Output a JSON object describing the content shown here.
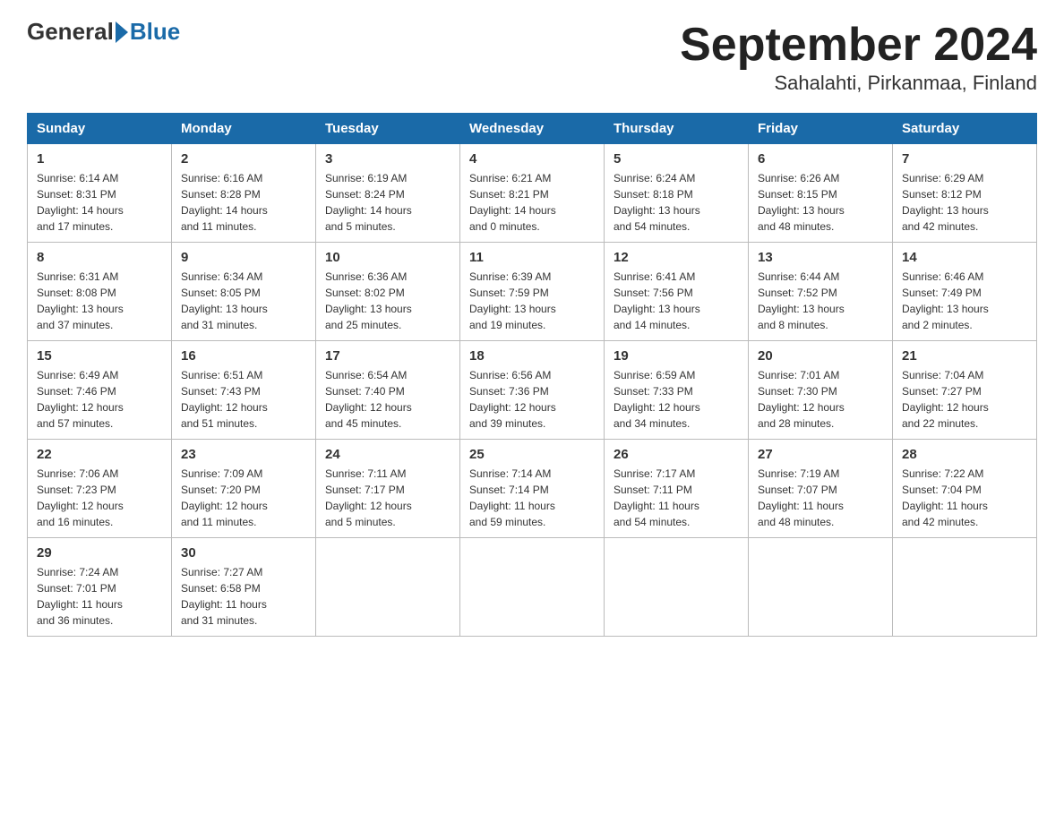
{
  "header": {
    "logo_general": "General",
    "logo_blue": "Blue",
    "month_title": "September 2024",
    "location": "Sahalahti, Pirkanmaa, Finland"
  },
  "days_of_week": [
    "Sunday",
    "Monday",
    "Tuesday",
    "Wednesday",
    "Thursday",
    "Friday",
    "Saturday"
  ],
  "weeks": [
    [
      {
        "day": "1",
        "sunrise": "6:14 AM",
        "sunset": "8:31 PM",
        "daylight": "14 hours and 17 minutes."
      },
      {
        "day": "2",
        "sunrise": "6:16 AM",
        "sunset": "8:28 PM",
        "daylight": "14 hours and 11 minutes."
      },
      {
        "day": "3",
        "sunrise": "6:19 AM",
        "sunset": "8:24 PM",
        "daylight": "14 hours and 5 minutes."
      },
      {
        "day": "4",
        "sunrise": "6:21 AM",
        "sunset": "8:21 PM",
        "daylight": "14 hours and 0 minutes."
      },
      {
        "day": "5",
        "sunrise": "6:24 AM",
        "sunset": "8:18 PM",
        "daylight": "13 hours and 54 minutes."
      },
      {
        "day": "6",
        "sunrise": "6:26 AM",
        "sunset": "8:15 PM",
        "daylight": "13 hours and 48 minutes."
      },
      {
        "day": "7",
        "sunrise": "6:29 AM",
        "sunset": "8:12 PM",
        "daylight": "13 hours and 42 minutes."
      }
    ],
    [
      {
        "day": "8",
        "sunrise": "6:31 AM",
        "sunset": "8:08 PM",
        "daylight": "13 hours and 37 minutes."
      },
      {
        "day": "9",
        "sunrise": "6:34 AM",
        "sunset": "8:05 PM",
        "daylight": "13 hours and 31 minutes."
      },
      {
        "day": "10",
        "sunrise": "6:36 AM",
        "sunset": "8:02 PM",
        "daylight": "13 hours and 25 minutes."
      },
      {
        "day": "11",
        "sunrise": "6:39 AM",
        "sunset": "7:59 PM",
        "daylight": "13 hours and 19 minutes."
      },
      {
        "day": "12",
        "sunrise": "6:41 AM",
        "sunset": "7:56 PM",
        "daylight": "13 hours and 14 minutes."
      },
      {
        "day": "13",
        "sunrise": "6:44 AM",
        "sunset": "7:52 PM",
        "daylight": "13 hours and 8 minutes."
      },
      {
        "day": "14",
        "sunrise": "6:46 AM",
        "sunset": "7:49 PM",
        "daylight": "13 hours and 2 minutes."
      }
    ],
    [
      {
        "day": "15",
        "sunrise": "6:49 AM",
        "sunset": "7:46 PM",
        "daylight": "12 hours and 57 minutes."
      },
      {
        "day": "16",
        "sunrise": "6:51 AM",
        "sunset": "7:43 PM",
        "daylight": "12 hours and 51 minutes."
      },
      {
        "day": "17",
        "sunrise": "6:54 AM",
        "sunset": "7:40 PM",
        "daylight": "12 hours and 45 minutes."
      },
      {
        "day": "18",
        "sunrise": "6:56 AM",
        "sunset": "7:36 PM",
        "daylight": "12 hours and 39 minutes."
      },
      {
        "day": "19",
        "sunrise": "6:59 AM",
        "sunset": "7:33 PM",
        "daylight": "12 hours and 34 minutes."
      },
      {
        "day": "20",
        "sunrise": "7:01 AM",
        "sunset": "7:30 PM",
        "daylight": "12 hours and 28 minutes."
      },
      {
        "day": "21",
        "sunrise": "7:04 AM",
        "sunset": "7:27 PM",
        "daylight": "12 hours and 22 minutes."
      }
    ],
    [
      {
        "day": "22",
        "sunrise": "7:06 AM",
        "sunset": "7:23 PM",
        "daylight": "12 hours and 16 minutes."
      },
      {
        "day": "23",
        "sunrise": "7:09 AM",
        "sunset": "7:20 PM",
        "daylight": "12 hours and 11 minutes."
      },
      {
        "day": "24",
        "sunrise": "7:11 AM",
        "sunset": "7:17 PM",
        "daylight": "12 hours and 5 minutes."
      },
      {
        "day": "25",
        "sunrise": "7:14 AM",
        "sunset": "7:14 PM",
        "daylight": "11 hours and 59 minutes."
      },
      {
        "day": "26",
        "sunrise": "7:17 AM",
        "sunset": "7:11 PM",
        "daylight": "11 hours and 54 minutes."
      },
      {
        "day": "27",
        "sunrise": "7:19 AM",
        "sunset": "7:07 PM",
        "daylight": "11 hours and 48 minutes."
      },
      {
        "day": "28",
        "sunrise": "7:22 AM",
        "sunset": "7:04 PM",
        "daylight": "11 hours and 42 minutes."
      }
    ],
    [
      {
        "day": "29",
        "sunrise": "7:24 AM",
        "sunset": "7:01 PM",
        "daylight": "11 hours and 36 minutes."
      },
      {
        "day": "30",
        "sunrise": "7:27 AM",
        "sunset": "6:58 PM",
        "daylight": "11 hours and 31 minutes."
      },
      null,
      null,
      null,
      null,
      null
    ]
  ],
  "labels": {
    "sunrise_label": "Sunrise:",
    "sunset_label": "Sunset:",
    "daylight_label": "Daylight:"
  }
}
